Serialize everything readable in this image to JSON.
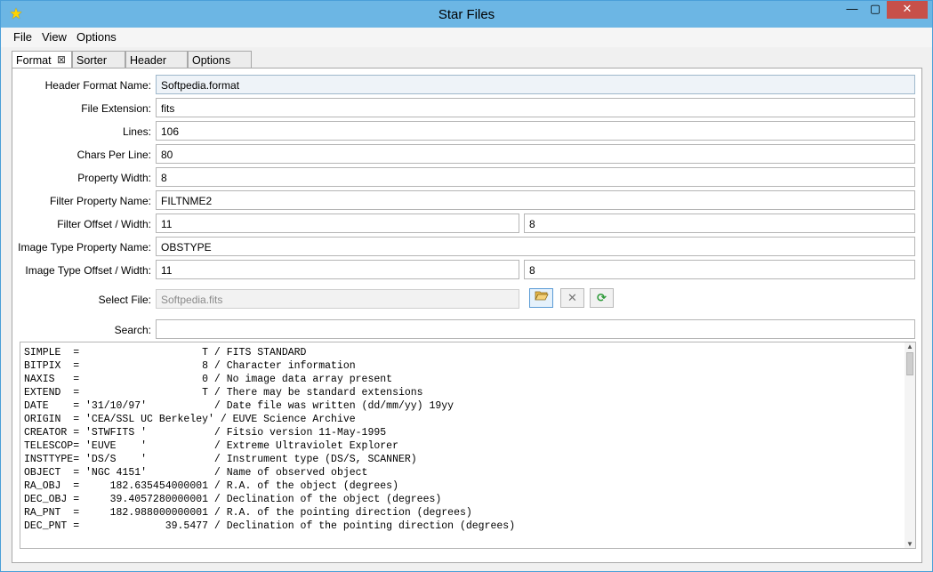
{
  "window": {
    "title": "Star Files",
    "app_icon": "star-icon"
  },
  "menu": [
    "File",
    "View",
    "Options"
  ],
  "tabs": [
    {
      "label": "Format",
      "closable": true
    },
    {
      "label": "Sorter"
    },
    {
      "label": "Header"
    },
    {
      "label": "Options"
    }
  ],
  "form": {
    "header_format_name": {
      "label": "Header Format Name:",
      "value": "Softpedia.format"
    },
    "file_extension": {
      "label": "File Extension:",
      "value": "fits"
    },
    "lines": {
      "label": "Lines:",
      "value": "106"
    },
    "chars_per_line": {
      "label": "Chars Per Line:",
      "value": "80"
    },
    "property_width": {
      "label": "Property Width:",
      "value": "8"
    },
    "filter_property_name": {
      "label": "Filter Property Name:",
      "value": "FILTNME2"
    },
    "filter_offset_width": {
      "label": "Filter Offset / Width:",
      "offset": "11",
      "width": "8"
    },
    "image_type_property_name": {
      "label": "Image Type Property Name:",
      "value": "OBSTYPE"
    },
    "image_type_offset_width": {
      "label": "Image Type Offset / Width:",
      "offset": "11",
      "width": "8"
    },
    "select_file": {
      "label": "Select File:",
      "value": "Softpedia.fits"
    },
    "search": {
      "label": "Search:",
      "value": ""
    }
  },
  "buttons": {
    "open": "folder-open-icon",
    "clear": "close-icon",
    "refresh": "refresh-icon"
  },
  "header_lines": [
    "SIMPLE  =                    T / FITS STANDARD",
    "BITPIX  =                    8 / Character information",
    "NAXIS   =                    0 / No image data array present",
    "EXTEND  =                    T / There may be standard extensions",
    "DATE    = '31/10/97'           / Date file was written (dd/mm/yy) 19yy",
    "ORIGIN  = 'CEA/SSL UC Berkeley' / EUVE Science Archive",
    "CREATOR = 'STWFITS '           / Fitsio version 11-May-1995",
    "TELESCOP= 'EUVE    '           / Extreme Ultraviolet Explorer",
    "INSTTYPE= 'DS/S    '           / Instrument type (DS/S, SCANNER)",
    "OBJECT  = 'NGC 4151'           / Name of observed object",
    "RA_OBJ  =     182.635454000001 / R.A. of the object (degrees)",
    "DEC_OBJ =     39.4057280000001 / Declination of the object (degrees)",
    "RA_PNT  =     182.988000000001 / R.A. of the pointing direction (degrees)",
    "DEC_PNT =              39.5477 / Declination of the pointing direction (degrees)"
  ]
}
